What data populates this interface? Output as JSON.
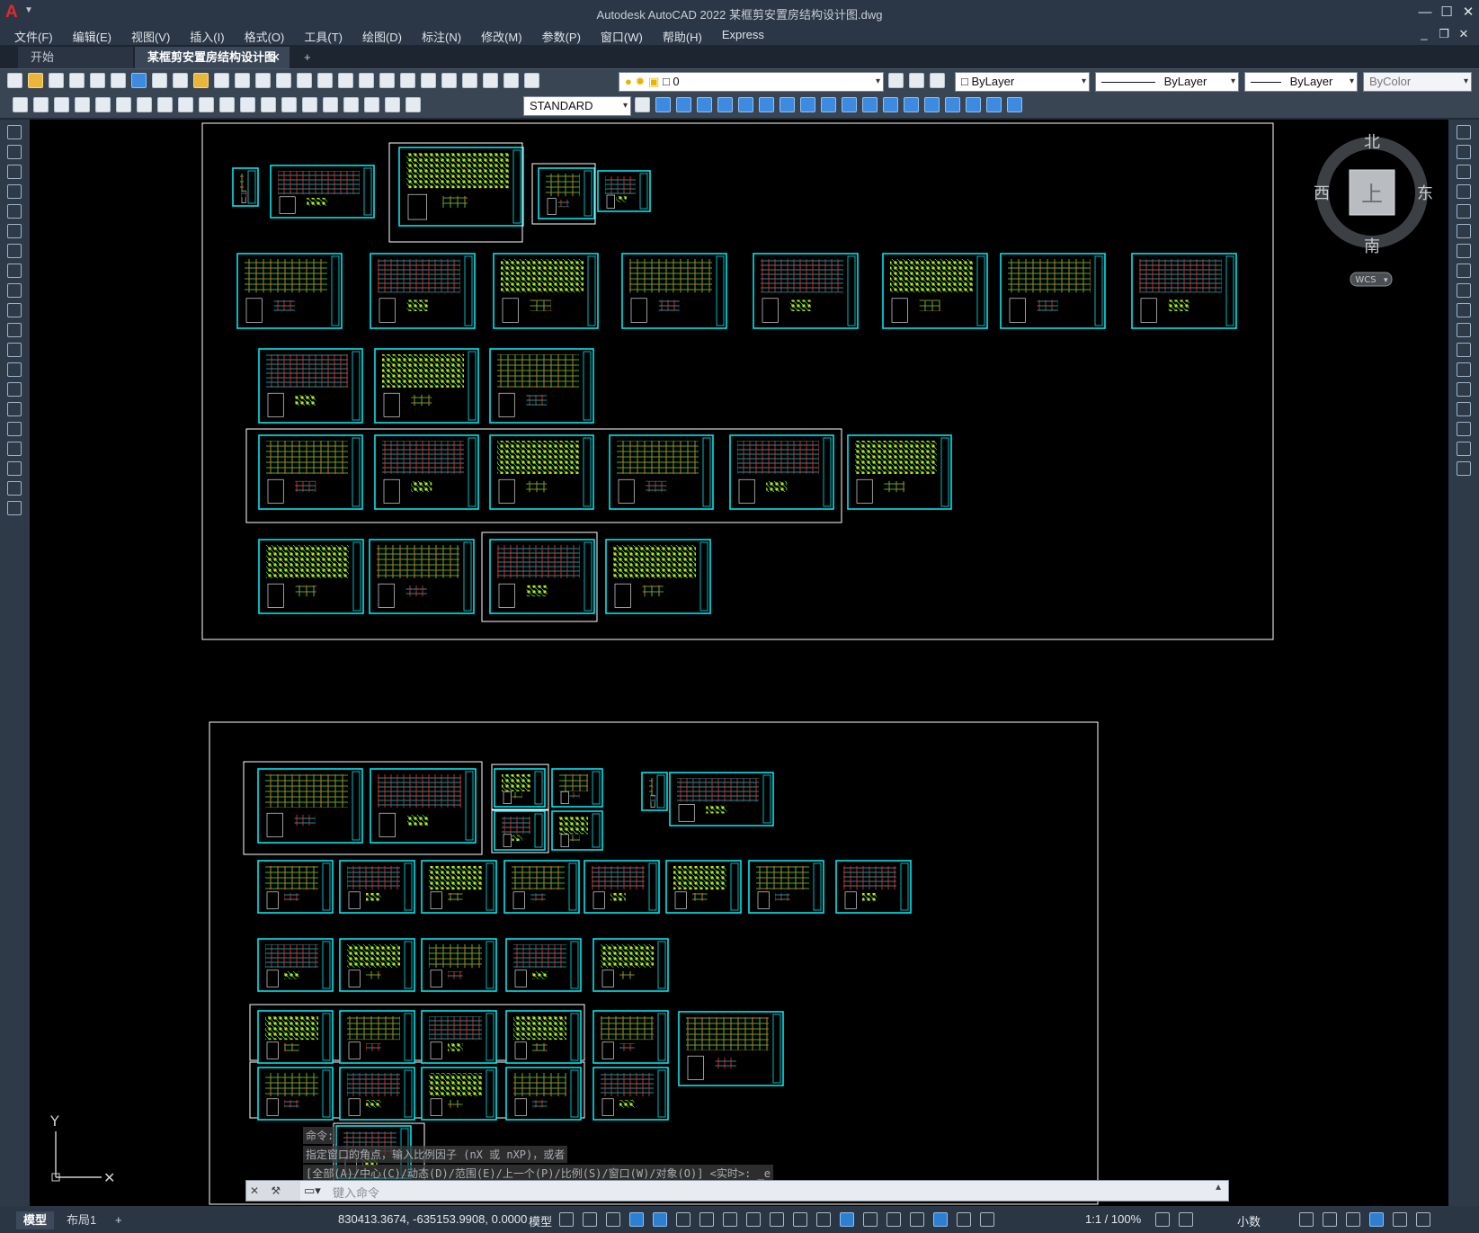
{
  "titlebar": {
    "app_logo": "A",
    "title": "Autodesk AutoCAD 2022    某框剪安置房结构设计图.dwg",
    "minimize": "—",
    "maximize": "☐",
    "close": "✕"
  },
  "menu": {
    "items": [
      "文件(F)",
      "编辑(E)",
      "视图(V)",
      "插入(I)",
      "格式(O)",
      "工具(T)",
      "绘图(D)",
      "标注(N)",
      "修改(M)",
      "参数(P)",
      "窗口(W)",
      "帮助(H)",
      "Express"
    ],
    "doc_minimize": "_",
    "doc_restore": "❐",
    "doc_close": "✕"
  },
  "tabs": {
    "start": "开始",
    "document": "某框剪安置房结构设计图*",
    "close": "✕",
    "new": "+"
  },
  "toolbar": {
    "layer_value": "0",
    "color_value": "ByLayer",
    "linetype_value": "ByLayer",
    "lineweight_value": "ByLayer",
    "plotstyle_value": "ByColor",
    "textstyle_value": "STANDARD",
    "dropdown_arrow": "▾"
  },
  "viewcube": {
    "north": "北",
    "south": "南",
    "east": "东",
    "west": "西",
    "top": "上",
    "wcs": "WCS"
  },
  "ucs": {
    "y_label": "Y",
    "x_label": "✕"
  },
  "command": {
    "history_1": "命令:",
    "history_2": "指定窗口的角点，输入比例因子 (nX 或 nXP)，或者",
    "history_3": "[全部(A)/中心(C)/动态(D)/范围(E)/上一个(P)/比例(S)/窗口(W)/对象(O)] <实时>: _e",
    "placeholder": "键入命令"
  },
  "status": {
    "tab_model": "模型",
    "tab_layout1": "布局1",
    "tab_add": "+",
    "coordinates": "830413.3674, -635153.9908, 0.0000",
    "model_label": "模型",
    "scale": "1:1 / 100%",
    "units": "小数"
  },
  "colors": {
    "cyan": "#00e5ee",
    "green": "#3cff3c",
    "red": "#ff2020",
    "yellow": "#ffe600",
    "white": "#ffffff"
  }
}
